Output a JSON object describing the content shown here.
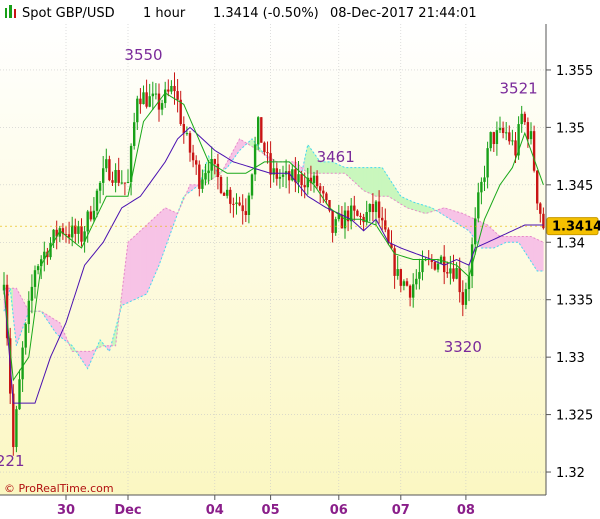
{
  "header": {
    "instrument": "Spot GBP/USD",
    "timeframe": "1 hour",
    "quote": "1.3414 (-0.50%)",
    "datetime": "08-Dec-2017 21:44:01"
  },
  "watermark": "© ProRealTime.com",
  "colors": {
    "bull": "#18a018",
    "bear": "#c81414",
    "tenkan": "#1aa81a",
    "kijun": "#4a10b0",
    "cloud_bear": "#f7c3e6",
    "cloud_bull": "#c9f7bd",
    "span_a_line": "#44d8f0",
    "annotation": "#7a2a9a",
    "last_price_box": "#f5c000",
    "background_top": "#ffffff",
    "background_bottom": "#fbf7c2"
  },
  "chart_data": {
    "type": "candlestick",
    "title": "Spot GBP/USD",
    "timeframe": "1 hour",
    "ylim": [
      1.318,
      1.359
    ],
    "yticks": [
      1.32,
      1.325,
      1.33,
      1.335,
      1.34,
      1.345,
      1.35,
      1.355
    ],
    "ytick_labels": [
      "1.32",
      "1.325",
      "1.33",
      "1.335",
      "1.34",
      "1.345",
      "1.35",
      "1.355"
    ],
    "xtick_labels": [
      {
        "label": "30",
        "i": 20
      },
      {
        "label": "Dec",
        "i": 40
      },
      {
        "label": "04",
        "i": 68
      },
      {
        "label": "05",
        "i": 86
      },
      {
        "label": "06",
        "i": 108
      },
      {
        "label": "07",
        "i": 128
      },
      {
        "label": "08",
        "i": 149
      }
    ],
    "last_price": 1.3414,
    "last_price_label": "1.3414",
    "grid": true,
    "annotations": [
      {
        "text": "3550",
        "i": 45,
        "value": 1.355
      },
      {
        "text": "3461",
        "i": 107,
        "value": 1.3461
      },
      {
        "text": "3320",
        "i": 148,
        "value": 1.332
      },
      {
        "text": "3521",
        "i": 166,
        "value": 1.3521
      },
      {
        "text": "221",
        "i": 2,
        "value": 1.3221
      }
    ],
    "anchors": {
      "close": [
        [
          0,
          1.3372
        ],
        [
          3,
          1.3221
        ],
        [
          6,
          1.3305
        ],
        [
          10,
          1.3378
        ],
        [
          18,
          1.3412
        ],
        [
          25,
          1.3405
        ],
        [
          33,
          1.3465
        ],
        [
          40,
          1.345
        ],
        [
          43,
          1.353
        ],
        [
          46,
          1.3525
        ],
        [
          50,
          1.352
        ],
        [
          55,
          1.3535
        ],
        [
          58,
          1.3495
        ],
        [
          63,
          1.3455
        ],
        [
          66,
          1.347
        ],
        [
          69,
          1.3455
        ],
        [
          73,
          1.344
        ],
        [
          78,
          1.343
        ],
        [
          82,
          1.35
        ],
        [
          86,
          1.346
        ],
        [
          91,
          1.3455
        ],
        [
          97,
          1.3455
        ],
        [
          101,
          1.345
        ],
        [
          104,
          1.343
        ],
        [
          106,
          1.341
        ],
        [
          111,
          1.3425
        ],
        [
          115,
          1.342
        ],
        [
          120,
          1.343
        ],
        [
          124,
          1.3395
        ],
        [
          127,
          1.337
        ],
        [
          131,
          1.336
        ],
        [
          136,
          1.338
        ],
        [
          141,
          1.3385
        ],
        [
          146,
          1.3375
        ],
        [
          148,
          1.335
        ],
        [
          150,
          1.3375
        ],
        [
          153,
          1.3435
        ],
        [
          157,
          1.349
        ],
        [
          162,
          1.3495
        ],
        [
          165,
          1.348
        ],
        [
          167,
          1.351
        ],
        [
          170,
          1.349
        ],
        [
          172,
          1.344
        ],
        [
          174,
          1.3414
        ]
      ],
      "tenkan": [
        [
          0,
          1.336
        ],
        [
          3,
          1.328
        ],
        [
          8,
          1.33
        ],
        [
          12,
          1.338
        ],
        [
          18,
          1.341
        ],
        [
          25,
          1.3395
        ],
        [
          33,
          1.344
        ],
        [
          40,
          1.344
        ],
        [
          45,
          1.3505
        ],
        [
          52,
          1.353
        ],
        [
          58,
          1.352
        ],
        [
          66,
          1.347
        ],
        [
          72,
          1.346
        ],
        [
          78,
          1.346
        ],
        [
          84,
          1.347
        ],
        [
          92,
          1.347
        ],
        [
          100,
          1.345
        ],
        [
          105,
          1.343
        ],
        [
          110,
          1.342
        ],
        [
          115,
          1.342
        ],
        [
          120,
          1.3415
        ],
        [
          126,
          1.339
        ],
        [
          132,
          1.3385
        ],
        [
          140,
          1.3385
        ],
        [
          146,
          1.338
        ],
        [
          150,
          1.337
        ],
        [
          155,
          1.342
        ],
        [
          160,
          1.345
        ],
        [
          164,
          1.3465
        ],
        [
          168,
          1.3495
        ],
        [
          172,
          1.3465
        ],
        [
          174,
          1.345
        ]
      ],
      "kijun": [
        [
          0,
          1.336
        ],
        [
          3,
          1.326
        ],
        [
          10,
          1.326
        ],
        [
          15,
          1.33
        ],
        [
          20,
          1.333
        ],
        [
          26,
          1.338
        ],
        [
          32,
          1.34
        ],
        [
          38,
          1.343
        ],
        [
          44,
          1.344
        ],
        [
          48,
          1.3455
        ],
        [
          52,
          1.347
        ],
        [
          56,
          1.349
        ],
        [
          60,
          1.35
        ],
        [
          64,
          1.349
        ],
        [
          68,
          1.348
        ],
        [
          74,
          1.347
        ],
        [
          80,
          1.3465
        ],
        [
          86,
          1.346
        ],
        [
          92,
          1.346
        ],
        [
          98,
          1.344
        ],
        [
          104,
          1.343
        ],
        [
          108,
          1.3425
        ],
        [
          112,
          1.342
        ],
        [
          116,
          1.341
        ],
        [
          120,
          1.342
        ],
        [
          124,
          1.34
        ],
        [
          128,
          1.3395
        ],
        [
          133,
          1.339
        ],
        [
          138,
          1.3385
        ],
        [
          142,
          1.338
        ],
        [
          146,
          1.3385
        ],
        [
          150,
          1.338
        ],
        [
          152,
          1.3395
        ],
        [
          156,
          1.34
        ],
        [
          160,
          1.3405
        ],
        [
          164,
          1.341
        ],
        [
          168,
          1.3415
        ],
        [
          174,
          1.3415
        ]
      ],
      "span_a": [
        [
          0,
          1.334
        ],
        [
          2,
          1.336
        ],
        [
          4,
          1.331
        ],
        [
          8,
          1.334
        ],
        [
          12,
          1.334
        ],
        [
          17,
          1.332
        ],
        [
          22,
          1.331
        ],
        [
          27,
          1.329
        ],
        [
          31,
          1.3315
        ],
        [
          34,
          1.3305
        ],
        [
          38,
          1.3345
        ],
        [
          42,
          1.335
        ],
        [
          46,
          1.3355
        ],
        [
          50,
          1.338
        ],
        [
          54,
          1.341
        ],
        [
          58,
          1.344
        ],
        [
          63,
          1.345
        ],
        [
          66,
          1.3475
        ],
        [
          69,
          1.346
        ],
        [
          72,
          1.3465
        ],
        [
          76,
          1.348
        ],
        [
          80,
          1.349
        ],
        [
          86,
          1.347
        ],
        [
          92,
          1.347
        ],
        [
          96,
          1.346
        ],
        [
          98,
          1.3485
        ],
        [
          102,
          1.347
        ],
        [
          106,
          1.347
        ],
        [
          110,
          1.3465
        ],
        [
          116,
          1.3465
        ],
        [
          122,
          1.3465
        ],
        [
          128,
          1.344
        ],
        [
          132,
          1.3435
        ],
        [
          138,
          1.343
        ],
        [
          144,
          1.342
        ],
        [
          150,
          1.341
        ],
        [
          154,
          1.3395
        ],
        [
          158,
          1.3395
        ],
        [
          162,
          1.34
        ],
        [
          166,
          1.34
        ],
        [
          172,
          1.3375
        ],
        [
          174,
          1.3375
        ]
      ],
      "span_b": [
        [
          0,
          1.336
        ],
        [
          4,
          1.336
        ],
        [
          8,
          1.334
        ],
        [
          12,
          1.334
        ],
        [
          18,
          1.333
        ],
        [
          22,
          1.3305
        ],
        [
          28,
          1.3305
        ],
        [
          32,
          1.331
        ],
        [
          36,
          1.331
        ],
        [
          40,
          1.34
        ],
        [
          44,
          1.341
        ],
        [
          48,
          1.342
        ],
        [
          52,
          1.343
        ],
        [
          56,
          1.3425
        ],
        [
          60,
          1.345
        ],
        [
          64,
          1.345
        ],
        [
          70,
          1.346
        ],
        [
          76,
          1.349
        ],
        [
          82,
          1.348
        ],
        [
          88,
          1.347
        ],
        [
          94,
          1.347
        ],
        [
          98,
          1.346
        ],
        [
          104,
          1.346
        ],
        [
          110,
          1.346
        ],
        [
          116,
          1.3445
        ],
        [
          120,
          1.344
        ],
        [
          124,
          1.344
        ],
        [
          130,
          1.343
        ],
        [
          136,
          1.3425
        ],
        [
          142,
          1.343
        ],
        [
          148,
          1.3425
        ],
        [
          152,
          1.342
        ],
        [
          156,
          1.3415
        ],
        [
          160,
          1.3405
        ],
        [
          166,
          1.3405
        ],
        [
          170,
          1.3405
        ],
        [
          174,
          1.34
        ]
      ]
    }
  }
}
